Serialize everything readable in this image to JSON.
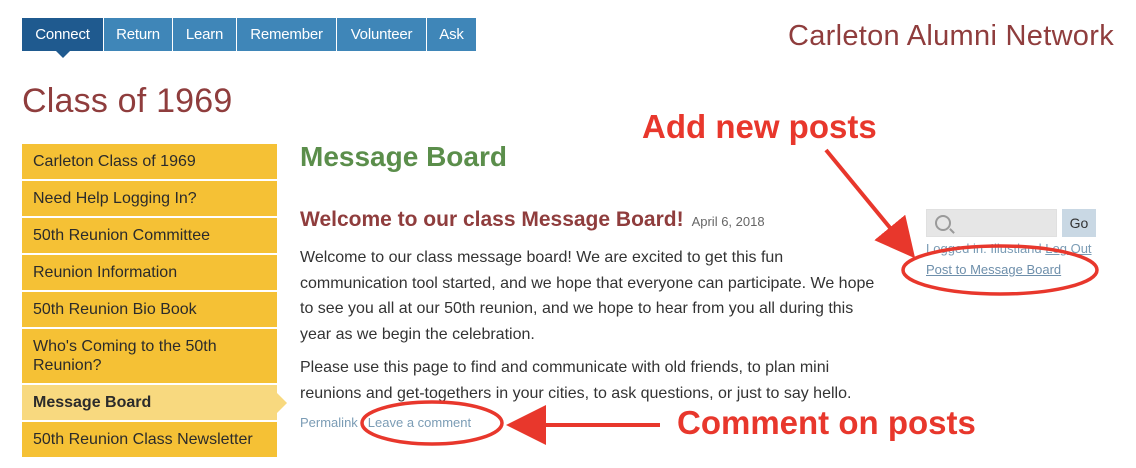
{
  "nav": {
    "tabs": [
      {
        "label": "Connect",
        "active": true
      },
      {
        "label": "Return",
        "active": false
      },
      {
        "label": "Learn",
        "active": false
      },
      {
        "label": "Remember",
        "active": false
      },
      {
        "label": "Volunteer",
        "active": false
      },
      {
        "label": "Ask",
        "active": false
      }
    ]
  },
  "site_title": "Carleton Alumni Network",
  "page_title": "Class of 1969",
  "sidebar": {
    "items": [
      {
        "label": "Carleton Class of 1969"
      },
      {
        "label": "Need Help Logging In?"
      },
      {
        "label": "50th Reunion Committee"
      },
      {
        "label": "Reunion Information"
      },
      {
        "label": "50th Reunion Bio Book"
      },
      {
        "label": "Who's Coming to the 50th Reunion?"
      },
      {
        "label": "Message Board",
        "active": true
      },
      {
        "label": "50th Reunion Class Newsletter"
      }
    ]
  },
  "main": {
    "heading": "Message Board",
    "post": {
      "title": "Welcome to our class Message Board!",
      "date": "April 6, 2018",
      "paragraphs": [
        "Welcome to our class message board! We are excited to get this fun communication tool started, and we hope that everyone can participate. We hope to see you all at our 50th reunion, and we hope to hear from you all during this year as we begin the celebration.",
        "Please use this page to find and communicate with old friends, to plan mini reunions and get-togethers in your cities, to ask questions, or just to say hello."
      ],
      "permalink_label": "Permalink",
      "comment_label": "Leave a comment"
    }
  },
  "right": {
    "search_placeholder": "",
    "go_label": "Go",
    "logged_in_text": "Logged in: Illustland",
    "logout_label": "Log Out",
    "post_link_label": "Post to Message Board"
  },
  "annotations": {
    "add_posts": "Add new posts",
    "comment_posts": "Comment on posts"
  },
  "colors": {
    "nav_blue": "#3f86b8",
    "nav_active": "#1f5a8f",
    "sidebar_yellow": "#f5c135",
    "sidebar_active": "#f8d97f",
    "heading_green": "#5b8e4b",
    "title_maroon": "#8f3d3d",
    "annotation_red": "#e8372c"
  }
}
